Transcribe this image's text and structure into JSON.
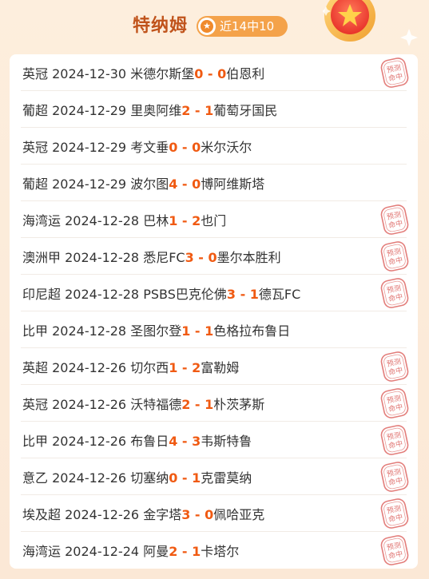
{
  "header": {
    "expert_name": "特纳姆",
    "record_label": "近14中10",
    "badge_icon": "star-icon",
    "medal_icon": "star-medal-icon"
  },
  "colors": {
    "accent": "#f05a12",
    "badge": "#f4a24a",
    "name": "#c0531b",
    "stamp": "#d9534f"
  },
  "stamp_text": "预测命中",
  "matches": [
    {
      "league": "英冠",
      "date": "2024-12-30",
      "home": "米德尔斯堡",
      "home_score": "0",
      "sep": " - ",
      "away_score": "0",
      "away": "伯恩利",
      "hit": true
    },
    {
      "league": "葡超",
      "date": "2024-12-29",
      "home": "里奥阿维",
      "home_score": "2",
      "sep": " - ",
      "away_score": "1",
      "away": "葡萄牙国民",
      "hit": false
    },
    {
      "league": "英冠",
      "date": "2024-12-29",
      "home": "考文垂",
      "home_score": "0",
      "sep": " - ",
      "away_score": "0",
      "away": "米尔沃尔",
      "hit": false
    },
    {
      "league": "葡超",
      "date": "2024-12-29",
      "home": "波尔图",
      "home_score": "4",
      "sep": " - ",
      "away_score": "0",
      "away": "博阿维斯塔",
      "hit": false
    },
    {
      "league": "海湾运",
      "date": "2024-12-28",
      "home": "巴林",
      "home_score": "1",
      "sep": " - ",
      "away_score": "2",
      "away": "也门",
      "hit": true
    },
    {
      "league": "澳洲甲",
      "date": "2024-12-28",
      "home": "悉尼FC",
      "home_score": "3",
      "sep": " - ",
      "away_score": "0",
      "away": "墨尔本胜利",
      "hit": true
    },
    {
      "league": "印尼超",
      "date": "2024-12-28",
      "home": "PSBS巴克伦佛",
      "home_score": "3",
      "sep": " - ",
      "away_score": "1",
      "away": "德瓦FC",
      "hit": true
    },
    {
      "league": "比甲",
      "date": "2024-12-28",
      "home": "圣图尔登",
      "home_score": "1",
      "sep": " - ",
      "away_score": "1",
      "away": "色格拉布鲁日",
      "hit": false
    },
    {
      "league": "英超",
      "date": "2024-12-26",
      "home": "切尔西",
      "home_score": "1",
      "sep": " - ",
      "away_score": "2",
      "away": "富勒姆",
      "hit": true
    },
    {
      "league": "英冠",
      "date": "2024-12-26",
      "home": "沃特福德",
      "home_score": "2",
      "sep": " - ",
      "away_score": "1",
      "away": "朴茨茅斯",
      "hit": true
    },
    {
      "league": "比甲",
      "date": "2024-12-26",
      "home": "布鲁日",
      "home_score": "4",
      "sep": " - ",
      "away_score": "3",
      "away": "韦斯特鲁",
      "hit": true
    },
    {
      "league": "意乙",
      "date": "2024-12-26",
      "home": "切塞纳",
      "home_score": "0",
      "sep": " - ",
      "away_score": "1",
      "away": "克雷莫纳",
      "hit": true
    },
    {
      "league": "埃及超",
      "date": "2024-12-26",
      "home": "金字塔",
      "home_score": "3",
      "sep": " - ",
      "away_score": "0",
      "away": "佩哈亚克",
      "hit": true
    },
    {
      "league": "海湾运",
      "date": "2024-12-24",
      "home": "阿曼",
      "home_score": "2",
      "sep": " - ",
      "away_score": "1",
      "away": "卡塔尔",
      "hit": true
    }
  ]
}
